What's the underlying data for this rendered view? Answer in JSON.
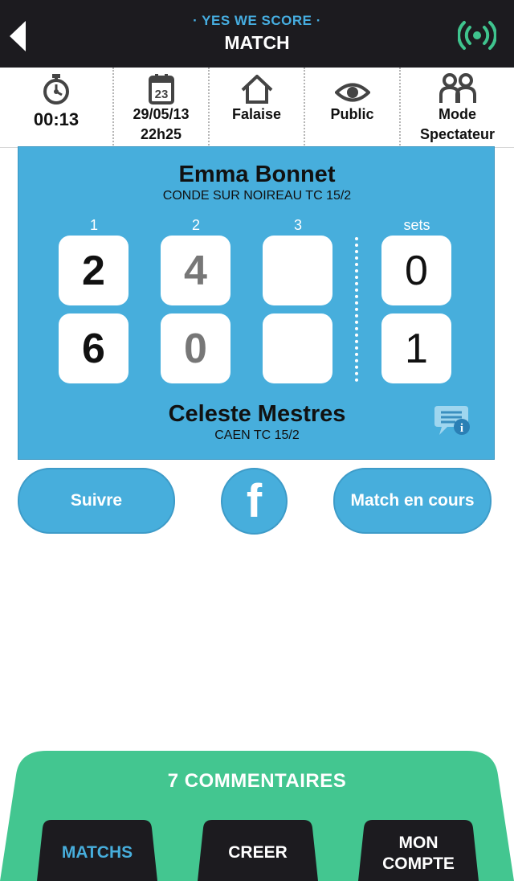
{
  "header": {
    "brand": "· YES WE SCORE ·",
    "title": "MATCH",
    "back_icon": "back-arrow-icon",
    "live_icon": "live-broadcast-icon",
    "accent_color": "#46ade0",
    "live_color": "#3fc48e"
  },
  "info": {
    "timer": "00:13",
    "date": "29/05/13",
    "time": "22h25",
    "calendar_day": "23",
    "location": "Falaise",
    "visibility": "Public",
    "mode_line1": "Mode",
    "mode_line2": "Spectateur",
    "icons": [
      "stopwatch-icon",
      "calendar-icon",
      "home-icon",
      "eye-icon",
      "users-icon"
    ]
  },
  "match": {
    "board_color": "#47aedc",
    "player1": {
      "name": "Emma Bonnet",
      "club": "CONDE SUR NOIREAU TC 15/2"
    },
    "player2": {
      "name": "Celeste Mestres",
      "club": "CAEN TC 15/2"
    },
    "columns": [
      "1",
      "2",
      "3",
      "sets"
    ],
    "player1_scores": [
      "2",
      "4",
      "",
      "0"
    ],
    "player2_scores": [
      "6",
      "0",
      "",
      "1"
    ]
  },
  "actions": {
    "follow": "Suivre",
    "facebook": "f",
    "status": "Match en cours"
  },
  "bottom": {
    "comments": "7 COMMENTAIRES",
    "panel_color": "#43c690",
    "tabs": [
      {
        "line1": "MATCHS",
        "line2": ""
      },
      {
        "line1": "CREER",
        "line2": ""
      },
      {
        "line1": "MON",
        "line2": "COMPTE"
      }
    ]
  }
}
